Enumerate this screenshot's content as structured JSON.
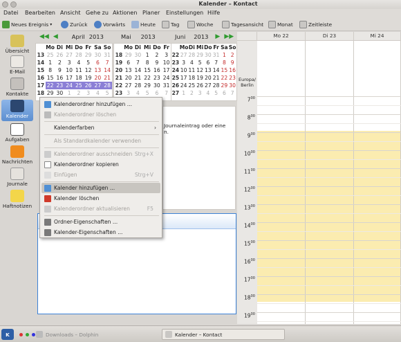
{
  "window": {
    "title": "Kalender – Kontact"
  },
  "menubar": [
    "Datei",
    "Bearbeiten",
    "Ansicht",
    "Gehe zu",
    "Aktionen",
    "Planer",
    "Einstellungen",
    "Hilfe"
  ],
  "toolbar": {
    "new_event": "Neues Ereignis",
    "back": "Zurück",
    "forward": "Vorwärts",
    "today": "Heute",
    "day": "Tag",
    "week": "Woche",
    "workweek": "Tagesansicht",
    "month": "Monat",
    "timeline": "Zeitleiste"
  },
  "sidebar": {
    "items": [
      {
        "label": "Übersicht"
      },
      {
        "label": "E-Mail"
      },
      {
        "label": "Kontakte"
      },
      {
        "label": "Kalender"
      },
      {
        "label": "Aufgaben"
      },
      {
        "label": "Nachrichten"
      },
      {
        "label": "Journale"
      },
      {
        "label": "Haftnotizen"
      }
    ]
  },
  "minicalendars": [
    {
      "month": "April",
      "year": "2013",
      "weeks": [
        "13",
        "14",
        "15",
        "16",
        "17",
        "18"
      ],
      "days": [
        [
          "25",
          "26",
          "27",
          "28",
          "29",
          "30",
          "31"
        ],
        [
          "1",
          "2",
          "3",
          "4",
          "5",
          "6",
          "7"
        ],
        [
          "8",
          "9",
          "10",
          "11",
          "12",
          "13",
          "14"
        ],
        [
          "15",
          "16",
          "17",
          "18",
          "19",
          "20",
          "21"
        ],
        [
          "22",
          "23",
          "24",
          "25",
          "26",
          "27",
          "28"
        ],
        [
          "29",
          "30",
          "1",
          "2",
          "3",
          "4",
          "5"
        ]
      ]
    },
    {
      "month": "Mai",
      "year": "2013",
      "weeks": [
        "18",
        "19",
        "20",
        "21",
        "22",
        "23"
      ],
      "days": [
        [
          "29",
          "30",
          "1",
          "2",
          "3",
          "4",
          "5"
        ],
        [
          "6",
          "7",
          "8",
          "9",
          "10",
          "11",
          "12"
        ],
        [
          "13",
          "14",
          "15",
          "16",
          "17",
          "18",
          "19"
        ],
        [
          "20",
          "21",
          "22",
          "23",
          "24",
          "25",
          "26"
        ],
        [
          "27",
          "28",
          "29",
          "30",
          "31",
          "1",
          "2"
        ],
        [
          "3",
          "4",
          "5",
          "6",
          "7",
          "8",
          "9"
        ]
      ]
    },
    {
      "month": "Juni",
      "year": "2013",
      "weeks": [
        "22",
        "23",
        "24",
        "25",
        "26",
        "27"
      ],
      "days": [
        [
          "27",
          "28",
          "29",
          "30",
          "31",
          "1",
          "2"
        ],
        [
          "3",
          "4",
          "5",
          "6",
          "7",
          "8",
          "9"
        ],
        [
          "10",
          "11",
          "12",
          "13",
          "14",
          "15",
          "16"
        ],
        [
          "17",
          "18",
          "19",
          "20",
          "21",
          "22",
          "23"
        ],
        [
          "24",
          "25",
          "26",
          "27",
          "28",
          "29",
          "30"
        ],
        [
          "1",
          "2",
          "3",
          "4",
          "5",
          "6",
          "7"
        ]
      ]
    }
  ],
  "weekday_header": [
    "Mo",
    "Di",
    "Mi",
    "Do",
    "Fr",
    "Sa",
    "So"
  ],
  "journal": {
    "line1": "Journaleintrag oder eine",
    "line2": "n."
  },
  "agenda": {
    "days": [
      "Mo 22",
      "Di 23",
      "Mi 24"
    ],
    "timezone": "Europa/\nBerlin",
    "hours": [
      "7",
      "8",
      "9",
      "10",
      "11",
      "12",
      "13",
      "14",
      "15",
      "16",
      "17",
      "18",
      "19"
    ],
    "minute_suffix": "00"
  },
  "context_menu": {
    "items": [
      {
        "label": "Kalenderordner hinzufügen ...",
        "shortcut": "",
        "disabled": false
      },
      {
        "label": "Kalenderordner löschen",
        "shortcut": "",
        "disabled": true
      },
      {
        "label": "Kalenderfarben",
        "shortcut": "",
        "disabled": false,
        "submenu": true
      },
      {
        "label": "Als Standardkalender verwenden",
        "shortcut": "",
        "disabled": true
      },
      {
        "label": "Kalenderordner ausschneiden",
        "shortcut": "Strg+X",
        "disabled": true
      },
      {
        "label": "Kalenderordner kopieren",
        "shortcut": "",
        "disabled": false
      },
      {
        "label": "Einfügen",
        "shortcut": "Strg+V",
        "disabled": true
      },
      {
        "label": "Kalender hinzufügen ...",
        "shortcut": "",
        "disabled": false,
        "highlighted": true
      },
      {
        "label": "Kalender löschen",
        "shortcut": "",
        "disabled": false
      },
      {
        "label": "Kalenderordner aktualisieren",
        "shortcut": "F5",
        "disabled": true
      },
      {
        "label": "Ordner-Eigenschaften ...",
        "shortcut": "",
        "disabled": false
      },
      {
        "label": "Kalender-Eigenschaften ...",
        "shortcut": "",
        "disabled": false
      }
    ]
  },
  "taskbar": {
    "dolphin": "Downloads – Dolphin",
    "kontact": "Kalender – Kontact"
  },
  "colors": {
    "accent": "#5d8fd0",
    "workhours": "#fbecb0",
    "selection_week": "#8b7fd6"
  }
}
